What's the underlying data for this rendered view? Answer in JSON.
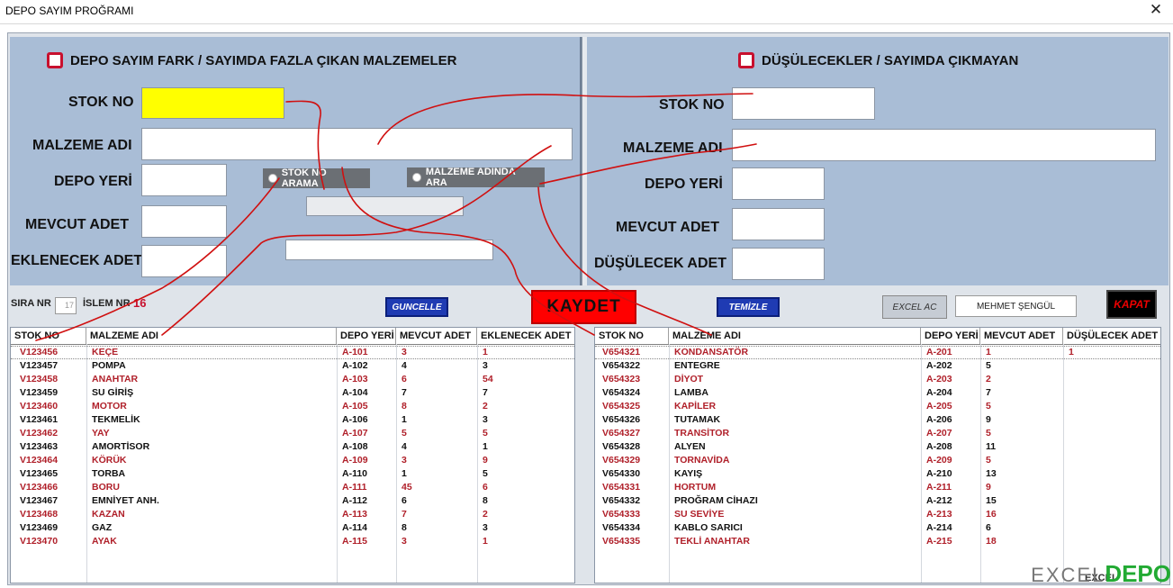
{
  "window": {
    "title": "DEPO SAYIM PROĞRAMI"
  },
  "left_panel": {
    "header": "DEPO SAYIM FARK  /  SAYIMDA FAZLA ÇIKAN MALZEMELER",
    "labels": {
      "stok_no": "STOK NO",
      "malzeme_adi": "MALZEME ADI",
      "depo_yeri": "DEPO YERİ",
      "mevcut_adet": "MEVCUT ADET",
      "eklenecek_adet": "EKLENECEK ADET"
    },
    "radio_stok": "STOK NO ARAMA",
    "radio_malzeme": "MALZEME ADINDA ARA"
  },
  "right_panel": {
    "header": "DÜŞÜLECEKLER  /  SAYIMDA ÇIKMAYAN",
    "labels": {
      "stok_no": "STOK NO",
      "malzeme_adi": "MALZEME ADI",
      "depo_yeri": "DEPO YERİ",
      "mevcut_adet": "MEVCUT ADET",
      "dusulecek_adet": "DÜŞÜLECEK ADET"
    }
  },
  "toolbar": {
    "sira_label": "SIRA NR",
    "sira_value": "17",
    "islem_label": "İSLEM NR",
    "islem_value": "16",
    "guncelle": "GUNCELLE",
    "kaydet": "KAYDET",
    "temizle": "TEMİZLE",
    "excel": "EXCEL AC",
    "user": "MEHMET ŞENGÜL",
    "kapat": "KAPAT"
  },
  "left_table": {
    "columns": [
      "STOK NO",
      "MALZEME ADI",
      "DEPO YERİ",
      "MEVCUT ADET",
      "EKLENECEK ADET"
    ],
    "rows": [
      [
        "V123456",
        "KEÇE",
        "A-101",
        "3",
        "1"
      ],
      [
        "V123457",
        "POMPA",
        "A-102",
        "4",
        "3"
      ],
      [
        "V123458",
        "ANAHTAR",
        "A-103",
        "6",
        "54"
      ],
      [
        "V123459",
        "SU GİRİŞ",
        "A-104",
        "7",
        "7"
      ],
      [
        "V123460",
        "MOTOR",
        "A-105",
        "8",
        "2"
      ],
      [
        "V123461",
        "TEKMELİK",
        "A-106",
        "1",
        "3"
      ],
      [
        "V123462",
        "YAY",
        "A-107",
        "5",
        "5"
      ],
      [
        "V123463",
        "AMORTİSOR",
        "A-108",
        "4",
        "1"
      ],
      [
        "V123464",
        "KÖRÜK",
        "A-109",
        "3",
        "9"
      ],
      [
        "V123465",
        "TORBA",
        "A-110",
        "1",
        "5"
      ],
      [
        "V123466",
        "BORU",
        "A-111",
        "45",
        "6"
      ],
      [
        "V123467",
        "EMNİYET ANH.",
        "A-112",
        "6",
        "8"
      ],
      [
        "V123468",
        "KAZAN",
        "A-113",
        "7",
        "2"
      ],
      [
        "V123469",
        "GAZ",
        "A-114",
        "8",
        "3"
      ],
      [
        "V123470",
        "AYAK",
        "A-115",
        "3",
        "1"
      ]
    ]
  },
  "right_table": {
    "columns": [
      "STOK NO",
      "MALZEME ADI",
      "DEPO YERİ",
      "MEVCUT ADET",
      "DÜŞÜLECEK ADET"
    ],
    "rows": [
      [
        "V654321",
        "KONDANSATÖR",
        "A-201",
        "1",
        "1"
      ],
      [
        "V654322",
        "ENTEGRE",
        "A-202",
        "5",
        ""
      ],
      [
        "V654323",
        "DİYOT",
        "A-203",
        "2",
        ""
      ],
      [
        "V654324",
        "LAMBA",
        "A-204",
        "7",
        ""
      ],
      [
        "V654325",
        "KAPİLER",
        "A-205",
        "5",
        ""
      ],
      [
        "V654326",
        "TUTAMAK",
        "A-206",
        "9",
        ""
      ],
      [
        "V654327",
        "TRANSİTOR",
        "A-207",
        "5",
        ""
      ],
      [
        "V654328",
        "ALYEN",
        "A-208",
        "11",
        ""
      ],
      [
        "V654329",
        "TORNAVİDA",
        "A-209",
        "5",
        ""
      ],
      [
        "V654330",
        "KAYIŞ",
        "A-210",
        "13",
        ""
      ],
      [
        "V654331",
        "HORTUM",
        "A-211",
        "9",
        ""
      ],
      [
        "V654332",
        "PROĞRAM CİHAZI",
        "A-212",
        "15",
        ""
      ],
      [
        "V654333",
        "SU SEVİYE",
        "A-213",
        "16",
        ""
      ],
      [
        "V654334",
        "KABLO SARICI",
        "A-214",
        "6",
        ""
      ],
      [
        "V654335",
        "TEKLİ ANAHTAR",
        "A-215",
        "18",
        ""
      ]
    ]
  },
  "watermark": {
    "part1": "EXCEL",
    "part2": "DEPO"
  },
  "colors": {
    "panel": "#a9bdd6",
    "accent_red": "#c8102e",
    "button_blue": "#1f3bb3",
    "yellow_field": "#ffff00"
  }
}
